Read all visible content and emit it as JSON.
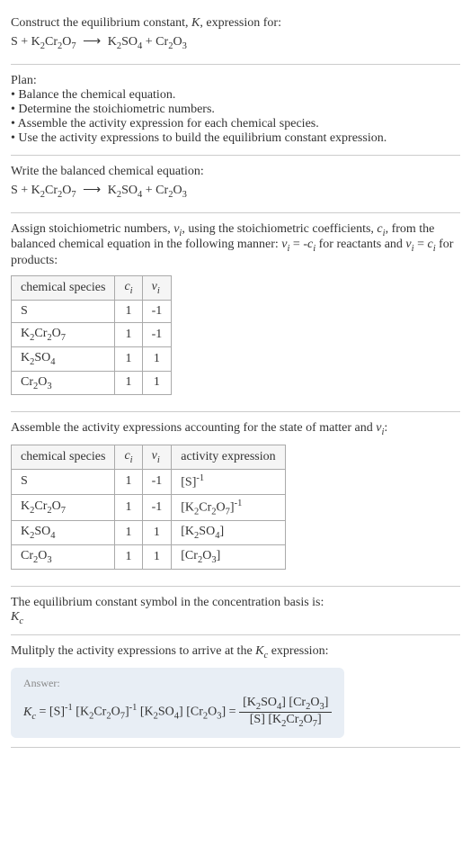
{
  "header": {
    "prompt": "Construct the equilibrium constant, K, expression for:",
    "equation_lhs": "S + K₂Cr₂O₇",
    "equation_rhs": "K₂SO₄ + Cr₂O₃"
  },
  "plan": {
    "title": "Plan:",
    "items": [
      "• Balance the chemical equation.",
      "• Determine the stoichiometric numbers.",
      "• Assemble the activity expression for each chemical species.",
      "• Use the activity expressions to build the equilibrium constant expression."
    ]
  },
  "balanced": {
    "title": "Write the balanced chemical equation:",
    "equation_lhs": "S + K₂Cr₂O₇",
    "equation_rhs": "K₂SO₄ + Cr₂O₃"
  },
  "stoich": {
    "text": "Assign stoichiometric numbers, νᵢ, using the stoichiometric coefficients, cᵢ, from the balanced chemical equation in the following manner: νᵢ = -cᵢ for reactants and νᵢ = cᵢ for products:",
    "headers": [
      "chemical species",
      "cᵢ",
      "νᵢ"
    ],
    "rows": [
      {
        "species": "S",
        "c": "1",
        "v": "-1"
      },
      {
        "species": "K₂Cr₂O₇",
        "c": "1",
        "v": "-1"
      },
      {
        "species": "K₂SO₄",
        "c": "1",
        "v": "1"
      },
      {
        "species": "Cr₂O₃",
        "c": "1",
        "v": "1"
      }
    ]
  },
  "activity": {
    "text": "Assemble the activity expressions accounting for the state of matter and νᵢ:",
    "headers": [
      "chemical species",
      "cᵢ",
      "νᵢ",
      "activity expression"
    ],
    "rows": [
      {
        "species": "S",
        "c": "1",
        "v": "-1",
        "expr": "[S]⁻¹"
      },
      {
        "species": "K₂Cr₂O₇",
        "c": "1",
        "v": "-1",
        "expr": "[K₂Cr₂O₇]⁻¹"
      },
      {
        "species": "K₂SO₄",
        "c": "1",
        "v": "1",
        "expr": "[K₂SO₄]"
      },
      {
        "species": "Cr₂O₃",
        "c": "1",
        "v": "1",
        "expr": "[Cr₂O₃]"
      }
    ]
  },
  "symbol": {
    "text": "The equilibrium constant symbol in the concentration basis is:",
    "value": "K_c"
  },
  "multiply": {
    "text": "Mulitply the activity expressions to arrive at the K_c expression:"
  },
  "answer": {
    "label": "Answer:",
    "kc_eq": "K_c = [S]⁻¹ [K₂Cr₂O₇]⁻¹ [K₂SO₄] [Cr₂O₃] =",
    "frac_num": "[K₂SO₄] [Cr₂O₃]",
    "frac_den": "[S] [K₂Cr₂O₇]"
  }
}
